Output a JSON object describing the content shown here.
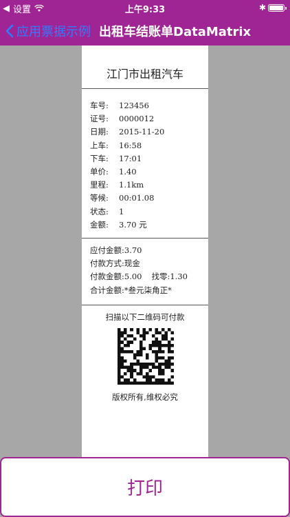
{
  "status_bar": {
    "back_app": "设置",
    "time": "上午9:33"
  },
  "nav": {
    "back_label": "应用票据示例",
    "title": "出租车结账单DataMatrix"
  },
  "receipt": {
    "title": "江门市出租汽车",
    "trip": [
      {
        "label": "车号:",
        "value": "123456"
      },
      {
        "label": "证号:",
        "value": "0000012"
      },
      {
        "label": "日期:",
        "value": "2015-11-20"
      },
      {
        "label": "上车:",
        "value": "16:58"
      },
      {
        "label": "下车:",
        "value": "17:01"
      },
      {
        "label": "单价:",
        "value": "1.40"
      },
      {
        "label": "里程:",
        "value": "1.1km"
      },
      {
        "label": "等候:",
        "value": "00:01.08"
      },
      {
        "label": "状态:",
        "value": "1"
      },
      {
        "label": "金额:",
        "value": "3.70 元"
      }
    ],
    "payment": {
      "due": "应付金额:3.70",
      "method": "付款方式:现金",
      "paid": "付款金额:5.00",
      "change": "找零:1.30",
      "total": "合计金额:*叁元柒角正*"
    },
    "scan_hint": "扫描以下二维码可付款",
    "copyright": "版权所有,维权必究"
  },
  "print_button": "打印",
  "colors": {
    "brand": "#a02594",
    "link": "#2f7dff",
    "backdrop": "#a7a7a7"
  }
}
